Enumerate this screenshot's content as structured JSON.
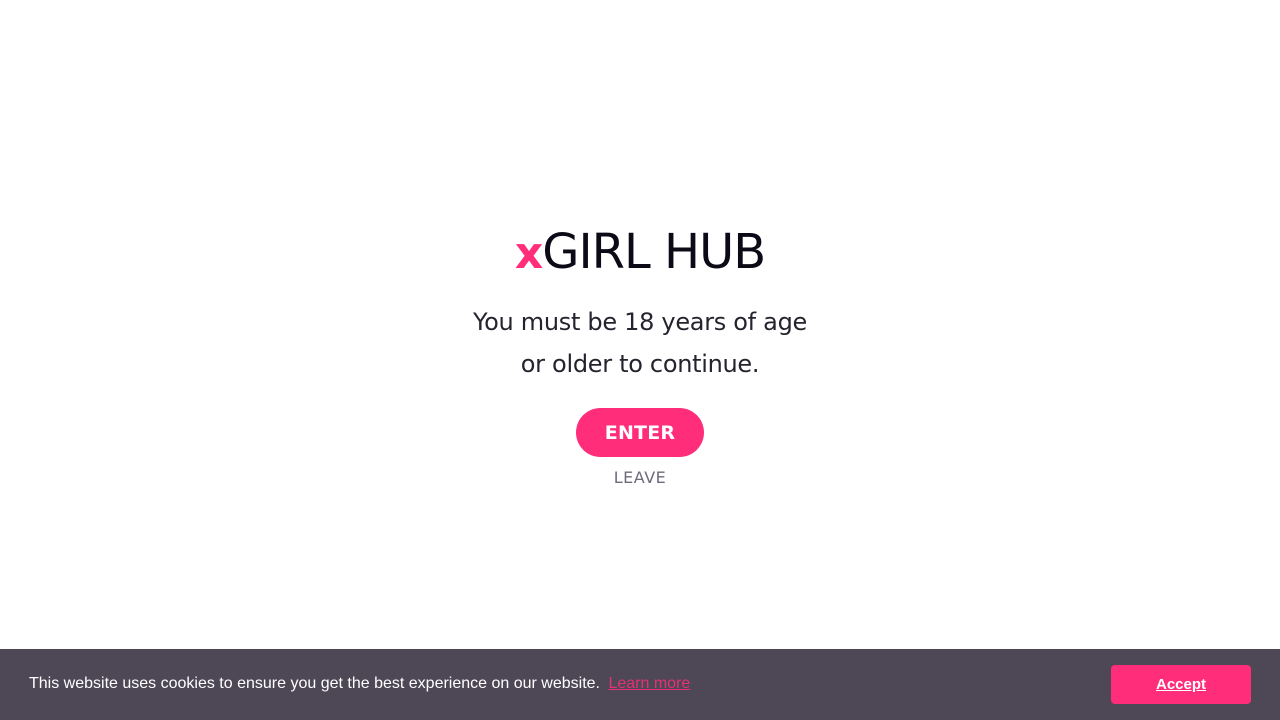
{
  "age_gate": {
    "logo_prefix": "x",
    "logo_name": "GIRL HUB",
    "message_line1": "You must be 18 years of age",
    "message_line2": "or older to continue.",
    "enter_label": "ENTER",
    "leave_label": "LEAVE"
  },
  "cookie_banner": {
    "message": "This website uses cookies to ensure you get the best experience on our website.",
    "learn_more_label": "Learn more",
    "accept_label": "Accept"
  },
  "colors": {
    "accent": "#ff2d7a",
    "text_dark": "#0d0a17",
    "banner_bg": "#4d4756",
    "muted": "#6e6b7a"
  }
}
